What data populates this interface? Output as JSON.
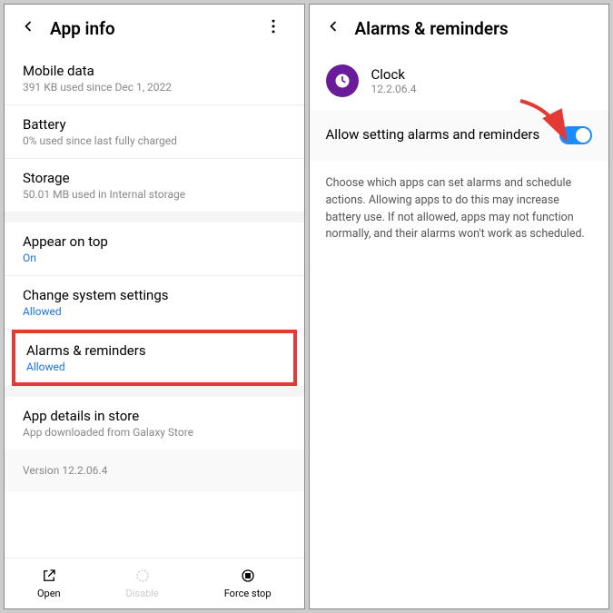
{
  "left": {
    "title": "App info",
    "items": [
      {
        "title": "Mobile data",
        "sub": "391 KB used since Dec 1, 2022"
      },
      {
        "title": "Battery",
        "sub": "0% used since last fully charged"
      },
      {
        "title": "Storage",
        "sub": "50.01 MB used in Internal storage"
      }
    ],
    "items2": [
      {
        "title": "Appear on top",
        "sub": "On"
      },
      {
        "title": "Change system settings",
        "sub": "Allowed"
      },
      {
        "title": "Alarms & reminders",
        "sub": "Allowed"
      }
    ],
    "details": {
      "title": "App details in store",
      "sub": "App downloaded from Galaxy Store"
    },
    "version": "Version 12.2.06.4",
    "buttons": {
      "open": "Open",
      "disable": "Disable",
      "forcestop": "Force stop"
    }
  },
  "right": {
    "title": "Alarms & reminders",
    "app": {
      "name": "Clock",
      "version": "12.2.06.4"
    },
    "toggleLabel": "Allow setting alarms and reminders",
    "desc": "Choose which apps can set alarms and schedule actions. Allowing apps to do this may increase battery use. If not allowed, apps may not function normally, and their alarms won't work as scheduled."
  }
}
